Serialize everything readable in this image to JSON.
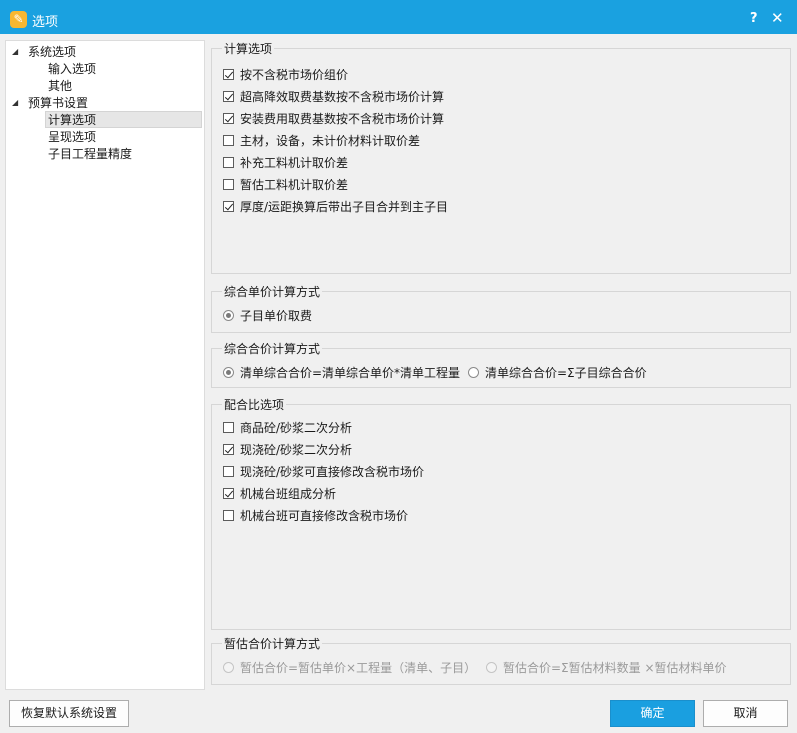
{
  "window": {
    "title": "选项",
    "help_label": "?",
    "close_label": "✕"
  },
  "tree": {
    "nodes": [
      {
        "label": "系统选项",
        "expanded": true
      },
      {
        "label": "输入选项"
      },
      {
        "label": "其他"
      },
      {
        "label": "预算书设置",
        "expanded": true
      },
      {
        "label": "计算选项",
        "selected": true
      },
      {
        "label": "呈现选项"
      },
      {
        "label": "子目工程量精度"
      }
    ],
    "expand_glyph": "◢"
  },
  "calc_options": {
    "title": "计算选项",
    "items": [
      {
        "label": "按不含税市场价组价",
        "checked": true
      },
      {
        "label": "超高降效取费基数按不含税市场价计算",
        "checked": true
      },
      {
        "label": "安装费用取费基数按不含税市场价计算",
        "checked": true
      },
      {
        "label": "主材，设备，未计价材料计取价差",
        "checked": false
      },
      {
        "label": "补充工料机计取价差",
        "checked": false
      },
      {
        "label": "暂估工料机计取价差",
        "checked": false
      },
      {
        "label": "厚度/运距换算后带出子目合并到主子目",
        "checked": true
      }
    ]
  },
  "unit_price_method": {
    "title": "综合单价计算方式",
    "options": [
      {
        "label": "子目单价取费",
        "selected": true
      }
    ]
  },
  "total_price_method": {
    "title": "综合合价计算方式",
    "options": [
      {
        "label": "清单综合合价=清单综合单价*清单工程量",
        "selected": true
      },
      {
        "label": "清单综合合价=Σ子目综合合价",
        "selected": false
      }
    ]
  },
  "mix_options": {
    "title": "配合比选项",
    "items": [
      {
        "label": "商品砼/砂浆二次分析",
        "checked": false
      },
      {
        "label": "现浇砼/砂浆二次分析",
        "checked": true
      },
      {
        "label": "现浇砼/砂浆可直接修改含税市场价",
        "checked": false
      },
      {
        "label": "机械台班组成分析",
        "checked": true
      },
      {
        "label": "机械台班可直接修改含税市场价",
        "checked": false
      }
    ]
  },
  "estimate_method": {
    "title": "暂估合价计算方式",
    "options": [
      {
        "label": "暂估合价=暂估单价×工程量（清单、子目）",
        "selected": false,
        "disabled": true
      },
      {
        "label": "暂估合价=Σ暂估材料数量 ×暂估材料单价",
        "selected": false,
        "disabled": true
      }
    ]
  },
  "footer": {
    "restore_label": "恢复默认系统设置",
    "ok_label": "确定",
    "cancel_label": "取消"
  },
  "colors": {
    "titlebar": "#1aa1e0",
    "primary_button": "#1a9fe0"
  }
}
